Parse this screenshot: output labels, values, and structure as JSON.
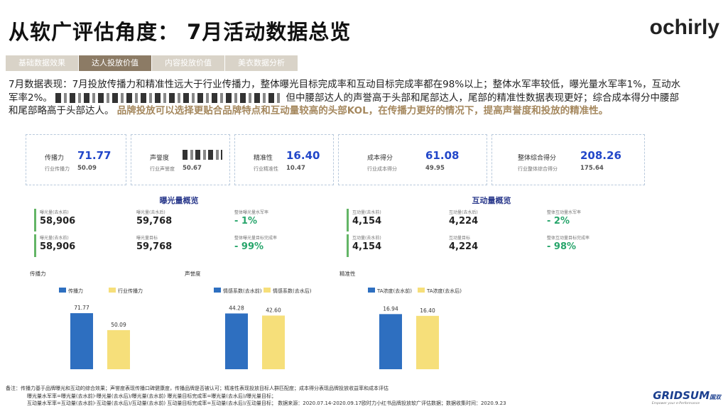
{
  "header": {
    "title": "从软广评估角度： 7月活动数据总览",
    "logo": "ochirly"
  },
  "tabs": [
    {
      "label": "基础数据效果",
      "active": false
    },
    {
      "label": "达人投放价值",
      "active": true
    },
    {
      "label": "内容投放价值",
      "active": false
    },
    {
      "label": "美衣数据分析",
      "active": false
    }
  ],
  "summary": {
    "part1": "7月数据表现：7月投放传播力和精准性远大于行业传播力，整体曝光目标完成率和互动目标完成率都在98%以上；整体水军率较低，曝光量水军率1%，互动水军率2%。",
    "part2": "但中腰部达人的声誉高于头部和尾部达人，尾部的精准性数据表现更好；综合成本得分中腰部和尾部略高于头部达人。",
    "highlight": "品牌投放可以选择更贴合品牌特点和互动量较高的头部KOL，在传播力更好的情况下，提高声誉度和投放的精准性。"
  },
  "kpis": [
    {
      "label": "传播力",
      "value": "71.77",
      "sub_label": "行业传播力",
      "sub_value": "50.09"
    },
    {
      "label": "声誉度",
      "value": "",
      "sub_label": "行业声誉度",
      "sub_value": "50.67"
    },
    {
      "label": "精准性",
      "value": "16.40",
      "sub_label": "行业精准性",
      "sub_value": "10.47"
    },
    {
      "label": "成本得分",
      "value": "61.08",
      "sub_label": "行业成本得分",
      "sub_value": "49.95"
    },
    {
      "label": "整体综合得分",
      "value": "208.26",
      "sub_label": "行业整体综合得分",
      "sub_value": "175.64"
    }
  ],
  "exposure": {
    "title": "曝光量概览",
    "r1": {
      "a_label": "曝光量(去水前)",
      "a_value": "58,906",
      "b_label": "曝光量(去水后)",
      "b_value": "59,768",
      "c_label": "整体曝光量水军率",
      "c_value": "- 1%"
    },
    "r2": {
      "a_label": "曝光量(去水前)",
      "a_value": "58,906",
      "b_label": "曝光量目标",
      "b_value": "59,768",
      "c_label": "整体曝光量目标完成率",
      "c_value": "- 99%"
    }
  },
  "interaction": {
    "title": "互动量概览",
    "r1": {
      "a_label": "互动量(去水前)",
      "a_value": "4,154",
      "b_label": "互动量(去水后)",
      "b_value": "4,224",
      "c_label": "整体互动量水军率",
      "c_value": "- 2%"
    },
    "r2": {
      "a_label": "互动量(去水前)",
      "a_value": "4,154",
      "b_label": "互动量目标",
      "b_value": "4,224",
      "c_label": "整体互动量目标完成率",
      "c_value": "- 98%"
    }
  },
  "chart_data": [
    {
      "type": "bar",
      "title": "传播力",
      "categories": [
        ""
      ],
      "series": [
        {
          "name": "传播力",
          "values": [
            71.77
          ],
          "color": "#2e6fc0"
        },
        {
          "name": "行业传播力",
          "values": [
            50.09
          ],
          "color": "#f6df7a"
        }
      ],
      "ylim": [
        0,
        100
      ]
    },
    {
      "type": "bar",
      "title": "声誉度",
      "categories": [
        ""
      ],
      "series": [
        {
          "name": "情感系数(去水前)",
          "values": [
            44.28
          ],
          "color": "#2e6fc0"
        },
        {
          "name": "情感系数(去水后)",
          "values": [
            42.6
          ],
          "color": "#f6df7a"
        }
      ],
      "ylim": [
        0,
        62
      ]
    },
    {
      "type": "bar",
      "title": "精准性",
      "categories": [
        ""
      ],
      "series": [
        {
          "name": "TA浓度(去水前)",
          "values": [
            16.94
          ],
          "color": "#2e6fc0"
        },
        {
          "name": "TA浓度(去水后)",
          "values": [
            16.4
          ],
          "color": "#f6df7a"
        }
      ],
      "ylim": [
        0,
        24
      ]
    }
  ],
  "notes": {
    "line1": "备注：传播力基于品牌曝光和互动的综合效果；声誉度表现传播口碑健康度，传播品牌是否被认可；精准性表现投放目标人群匹配度；成本得分表现品牌投放收益率和成本评估",
    "line2": "曝光量水军率=曝光量(去水前)-曝光量(去水后)/曝光量(去水前)     曝光量目标完成率=曝光量(去水后)/曝光量目标；",
    "line3": "互动量水军率=互动量(去水前)-互动量(去水后)/互动量(去水前)     互动量目标完成率=互动量(去水后)/互动量目标；  数据来源：2020.07.14-2020.09.17欧时力小红书品牌投放软广评估数据；数据收集时间：2020.9.23"
  },
  "footer": {
    "brand": "GRIDSUM",
    "brand_cn": "国双",
    "tagline": "Empower your e-Performance"
  }
}
